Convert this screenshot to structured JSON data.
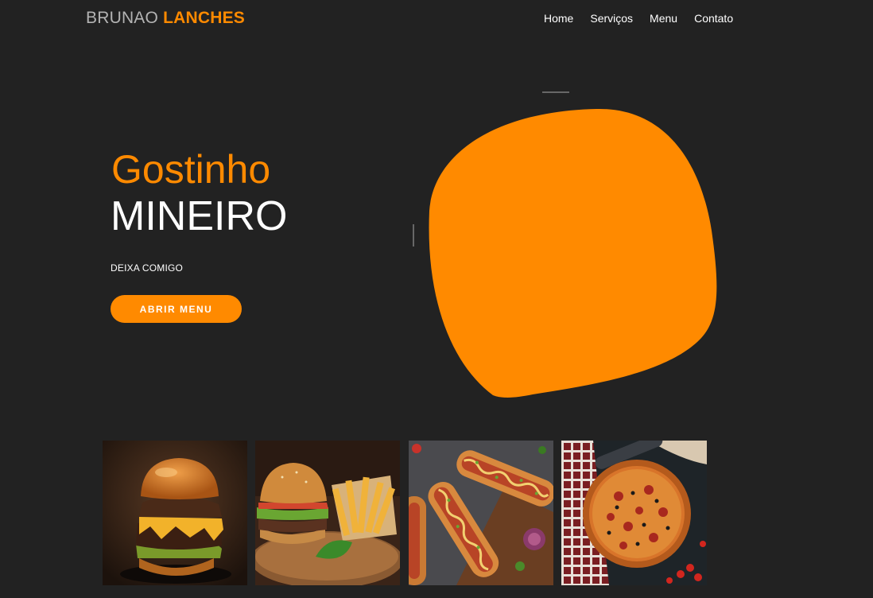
{
  "header": {
    "logo_part1": "BRUNAO",
    "logo_part2": "LANCHES",
    "nav": [
      {
        "label": "Home"
      },
      {
        "label": "Serviços"
      },
      {
        "label": "Menu"
      },
      {
        "label": "Contato"
      }
    ]
  },
  "hero": {
    "title_line1": "Gostinho",
    "title_line2": "MINEIRO",
    "subtitle": "DEIXA COMIGO",
    "button_label": "ABRIR MENU"
  },
  "gallery": [
    {
      "icon": "burger-image"
    },
    {
      "icon": "burger-fries-image"
    },
    {
      "icon": "hotdog-image"
    },
    {
      "icon": "pizza-image"
    }
  ],
  "colors": {
    "background": "#222222",
    "accent": "#ff8a00",
    "text": "#ffffff",
    "logo_grey": "#b3b3b3"
  }
}
